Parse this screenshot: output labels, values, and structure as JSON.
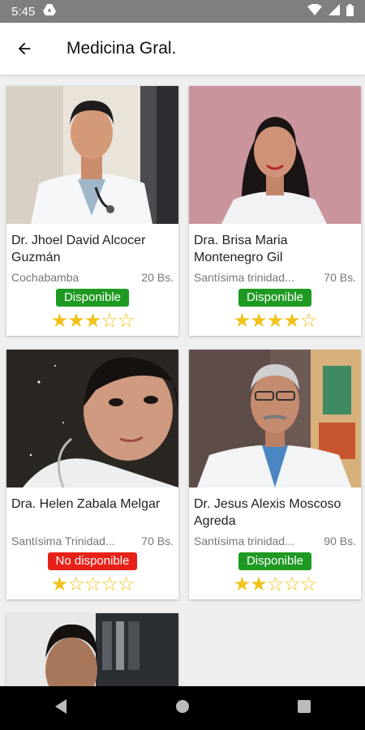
{
  "status": {
    "time": "5:45"
  },
  "appbar": {
    "title": "Medicina Gral."
  },
  "colors": {
    "available": "#1e9a22",
    "unavailable": "#e82118",
    "star": "#f2c21b"
  },
  "doctors": [
    {
      "name": "Dr. Jhoel David Alcocer Guzmán",
      "location": "Cochabamba",
      "price": "20 Bs.",
      "status": "Disponible",
      "available": true,
      "rating": 3
    },
    {
      "name": "Dra. Brisa Maria Montenegro Gil",
      "location": "Santísima trinidad...",
      "price": "70 Bs.",
      "status": "Disponible",
      "available": true,
      "rating": 4
    },
    {
      "name": "Dra. Helen Zabala Melgar",
      "location": "Santísima Trinidad...",
      "price": "70 Bs.",
      "status": "No disponible",
      "available": false,
      "rating": 1
    },
    {
      "name": "Dr. Jesus Alexis Moscoso Agreda",
      "location": "Santísima trinidad...",
      "price": "90 Bs.",
      "status": "Disponible",
      "available": true,
      "rating": 2
    }
  ]
}
